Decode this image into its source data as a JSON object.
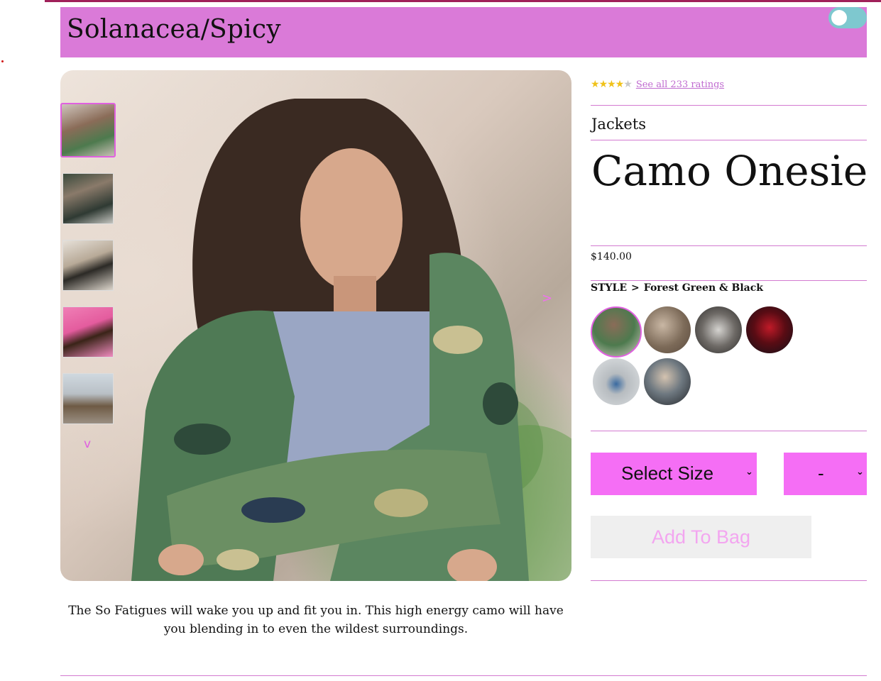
{
  "header": {
    "brand": "Solanacea/Spicy",
    "toggle_on": false
  },
  "gallery": {
    "thumbnails": [
      {
        "name": "camo-jacket-closeup",
        "active": true
      },
      {
        "name": "camo-jacket-sitting",
        "active": false
      },
      {
        "name": "camo-jacket-backpack",
        "active": false
      },
      {
        "name": "camo-jacket-pink-backdrop",
        "active": false
      },
      {
        "name": "camo-jacket-train-tracks",
        "active": false
      }
    ],
    "down_arrow": "v",
    "next_arrow": ">"
  },
  "description": "The So Fatigues will wake you up and fit you in. This high energy camo will have you blending in to even the wildest surroundings.",
  "product": {
    "rating": 4,
    "rating_max": 5,
    "ratings_link": "See all 233 ratings",
    "category": "Jackets",
    "title": "Camo Onesie",
    "price": "$140.00",
    "style_label": "STYLE",
    "style_separator": ">",
    "style_value": "Forest Green & Black",
    "styles": [
      {
        "name": "Forest Green & Black",
        "active": true
      },
      {
        "name": "style-2",
        "active": false
      },
      {
        "name": "style-3",
        "active": false
      },
      {
        "name": "style-4",
        "active": false
      },
      {
        "name": "style-5",
        "active": false
      },
      {
        "name": "style-6",
        "active": false
      }
    ]
  },
  "controls": {
    "size_select": "Select Size",
    "qty_select": "-",
    "add_to_bag": "Add To Bag"
  },
  "colors": {
    "header_bg": "#da7ad8",
    "accent": "#f56ef5",
    "rule": "#d37ad0",
    "toggle": "#7ec8cf",
    "star": "#f0c21a"
  }
}
